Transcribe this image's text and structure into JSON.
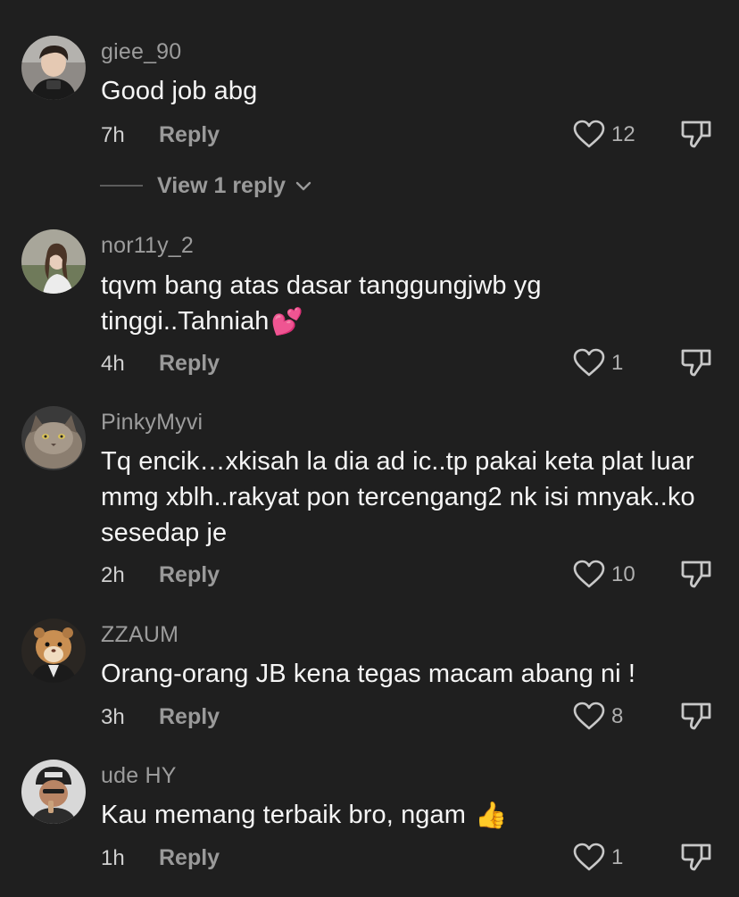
{
  "comments": [
    {
      "username": "giee_90",
      "text": "Good job abg",
      "emoji": "",
      "time": "7h",
      "reply_label": "Reply",
      "likes": "12",
      "avatar_icon": "user-photo-avatar"
    },
    {
      "username": "nor11y_2",
      "text": "tqvm bang atas dasar tanggungjwb yg tinggi..Tahniah",
      "emoji": "💕",
      "time": "4h",
      "reply_label": "Reply",
      "likes": "1",
      "avatar_icon": "user-photo-avatar"
    },
    {
      "username": "PinkyMyvi",
      "text": "Tq encik…xkisah la dia ad ic..tp pakai keta plat luar mmg xblh..rakyat pon tercengang2 nk isi mnyak..ko sesedap je",
      "emoji": "",
      "time": "2h",
      "reply_label": "Reply",
      "likes": "10",
      "avatar_icon": "cat-avatar"
    },
    {
      "username": "ZZAUM",
      "text": "Orang-orang JB kena tegas macam abang ni !",
      "emoji": "",
      "time": "3h",
      "reply_label": "Reply",
      "likes": "8",
      "avatar_icon": "hamster-avatar"
    },
    {
      "username": "ude HY",
      "text": "Kau memang terbaik bro, ngam",
      "emoji": "👍",
      "time": "1h",
      "reply_label": "Reply",
      "likes": "1",
      "avatar_icon": "user-photo-avatar"
    }
  ],
  "view_replies_label": "View 1 reply",
  "colors": {
    "background": "#1f1f1f",
    "username": "#9c9c9c",
    "text": "#f5f5f5",
    "secondary": "#9a9a9a"
  },
  "icons": {
    "like": "heart-outline-icon",
    "dislike": "thumbs-down-icon",
    "expand": "chevron-down-icon"
  }
}
